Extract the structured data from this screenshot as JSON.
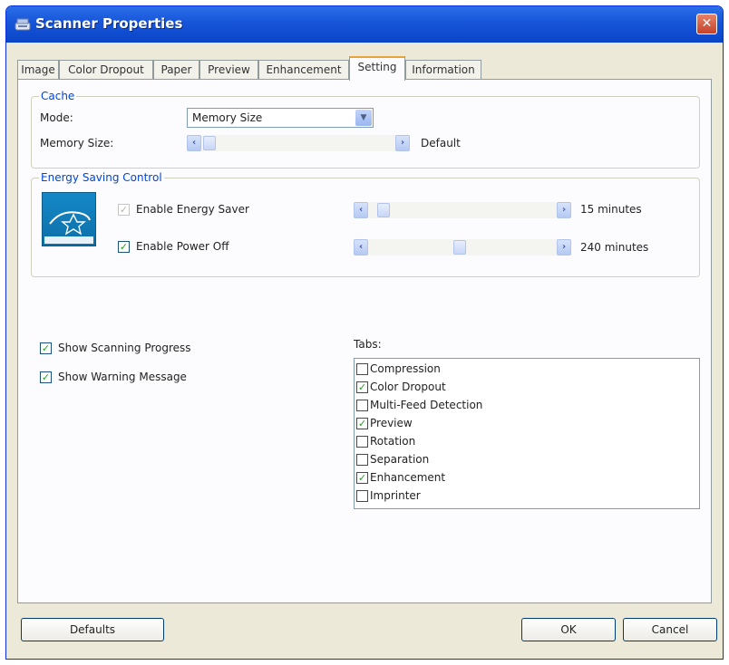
{
  "window": {
    "title": "Scanner Properties"
  },
  "tabs": [
    "Image",
    "Color Dropout",
    "Paper",
    "Preview",
    "Enhancement",
    "Setting",
    "Information"
  ],
  "active_tab": "Setting",
  "cache": {
    "group_label": "Cache",
    "mode_label": "Mode:",
    "mode_value": "Memory Size",
    "memory_size_label": "Memory Size:",
    "memory_size_value": "Default"
  },
  "energy": {
    "group_label": "Energy Saving Control",
    "enable_saver_label": "Enable Energy Saver",
    "enable_saver_checked": true,
    "enable_saver_enabled": false,
    "saver_value": "15 minutes",
    "enable_power_off_label": "Enable Power Off",
    "enable_power_off_checked": true,
    "power_off_value": "240 minutes"
  },
  "options": {
    "show_scanning_progress": "Show Scanning Progress",
    "show_scanning_progress_checked": true,
    "show_warning_message": "Show Warning Message",
    "show_warning_message_checked": true
  },
  "tabs_list": {
    "label": "Tabs:",
    "items": [
      {
        "label": "Compression",
        "checked": false
      },
      {
        "label": "Color Dropout",
        "checked": true
      },
      {
        "label": "Multi-Feed Detection",
        "checked": false
      },
      {
        "label": "Preview",
        "checked": true
      },
      {
        "label": "Rotation",
        "checked": false
      },
      {
        "label": "Separation",
        "checked": false
      },
      {
        "label": "Enhancement",
        "checked": true
      },
      {
        "label": "Imprinter",
        "checked": false
      }
    ]
  },
  "buttons": {
    "defaults": "Defaults",
    "ok": "OK",
    "cancel": "Cancel"
  },
  "icons": {
    "close": "close-icon",
    "scanner": "scanner-icon",
    "energy_star": "energy-star-logo",
    "arrow_left": "chevron-left-icon",
    "arrow_right": "chevron-right-icon",
    "dropdown": "chevron-down-icon"
  },
  "colors": {
    "titlebar": "#0b45c7",
    "group_label": "#0046d5",
    "check": "#21a121",
    "close_button": "#c6412a"
  }
}
